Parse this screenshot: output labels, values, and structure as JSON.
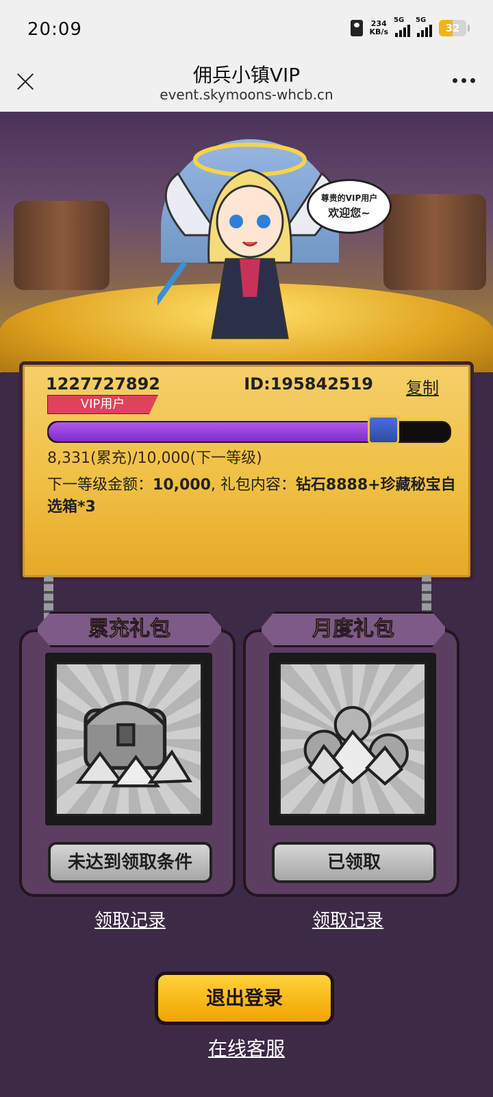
{
  "status_bar": {
    "time": "20:09",
    "speed_value": "234",
    "speed_unit": "KB/s",
    "signal1_label": "5G",
    "signal2_label": "5G",
    "battery": "32"
  },
  "titlebar": {
    "title": "佣兵小镇VIP",
    "url": "event.skymoons-whcb.cn"
  },
  "banner": {
    "speech_line1": "尊贵的VIP用户",
    "speech_line2": "欢迎您~"
  },
  "card": {
    "user_number": "1227727892",
    "id_text": "ID:195842519",
    "copy_label": "复制",
    "vip_label": "VIP用户",
    "progress_text": "8,331(累充)/10,000(下一等级)",
    "progress_fraction": 0.8331,
    "desc_prefix": "下一等级金额：",
    "desc_amount": "10,000",
    "desc_mid": ", 礼包内容：",
    "desc_content": "钻石8888+珍藏秘宝自选箱*3"
  },
  "gifts": [
    {
      "title": "累充礼包",
      "button": "未达到领取条件",
      "record": "领取记录",
      "icon": "treasure-chest-icon"
    },
    {
      "title": "月度礼包",
      "button": "已领取",
      "record": "领取记录",
      "icon": "gem-coins-icon"
    }
  ],
  "bottom": {
    "logout": "退出登录",
    "service": "在线客服"
  },
  "colors": {
    "background": "#3d2a46",
    "card_gold": "#f0c044",
    "progress_purple": "#9b3fe0",
    "vip_badge": "#e0425a",
    "logout_yellow": "#ffc31a"
  }
}
